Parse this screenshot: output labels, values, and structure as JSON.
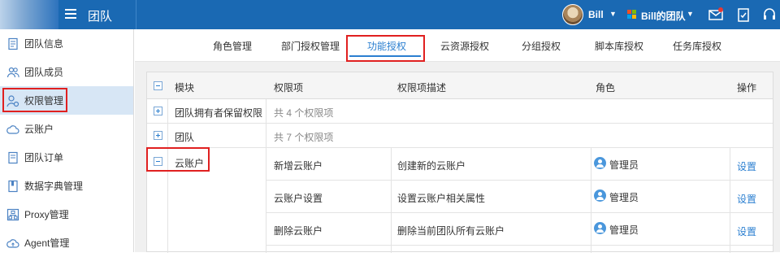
{
  "topbar": {
    "title": "团队",
    "user_name": "Bill",
    "team_name": "Bill的团队",
    "colors": {
      "bar": "#1a69b3",
      "accent": "#2b7fd0",
      "highlight": "#e02020"
    }
  },
  "sidebar": {
    "items": [
      {
        "label": "团队信息",
        "icon": "document-icon"
      },
      {
        "label": "团队成员",
        "icon": "users-icon"
      },
      {
        "label": "权限管理",
        "icon": "user-gear-icon",
        "active": true
      },
      {
        "label": "云账户",
        "icon": "cloud-icon"
      },
      {
        "label": "团队订单",
        "icon": "document-icon"
      },
      {
        "label": "数据字典管理",
        "icon": "book-icon"
      },
      {
        "label": "Proxy管理",
        "icon": "network-icon"
      },
      {
        "label": "Agent管理",
        "icon": "cloud-upload-icon"
      }
    ]
  },
  "tabs": [
    {
      "label": "角色管理"
    },
    {
      "label": "部门授权管理"
    },
    {
      "label": "功能授权",
      "active": true
    },
    {
      "label": "云资源授权"
    },
    {
      "label": "分组授权"
    },
    {
      "label": "脚本库授权"
    },
    {
      "label": "任务库授权"
    }
  ],
  "table": {
    "headers": [
      "模块",
      "权限项",
      "权限项描述",
      "角色",
      "操作"
    ],
    "groups": [
      {
        "module": "团队拥有者保留权限",
        "summary": "共 4 个权限项",
        "expanded": false
      },
      {
        "module": "团队",
        "summary": "共 7 个权限项",
        "expanded": false
      },
      {
        "module": "云账户",
        "expanded": true,
        "rows": [
          {
            "item": "新增云账户",
            "desc": "创建新的云账户",
            "role": "管理员",
            "action": "设置"
          },
          {
            "item": "云账户设置",
            "desc": "设置云账户相关属性",
            "role": "管理员",
            "action": "设置"
          },
          {
            "item": "删除云账户",
            "desc": "删除当前团队所有云账户",
            "role": "管理员",
            "action": "设置"
          }
        ]
      }
    ]
  }
}
